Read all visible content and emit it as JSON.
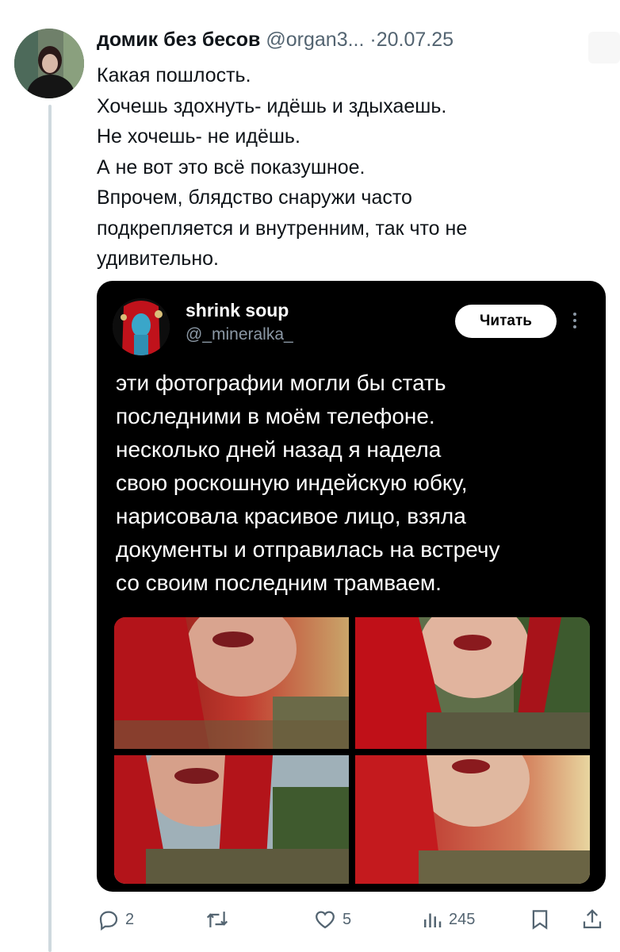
{
  "tweet": {
    "author_name": "домик без бесов",
    "author_handle": "@organ3...",
    "separator": "·",
    "date": "20.07.25",
    "lines": [
      "Какая пошлость.",
      "Хочешь здохнуть- идёшь и здыхаешь.",
      "Не хочешь- не идёшь.",
      "А не вот это всё показушное.",
      "Впрочем, блядство снаружи часто",
      "подкрепляется и внутренним, так что не",
      "удивительно."
    ]
  },
  "quoted": {
    "author_name": "shrink soup",
    "author_handle": "@_mineralka_",
    "read_button": "Читать",
    "lines": [
      "эти фотографии могли бы стать",
      "последними в моём телефоне.",
      "несколько дней назад я надела",
      "свою роскошную индейскую юбку,",
      "нарисовала красивое лицо, взяла",
      "документы и отправилась на встречу",
      "со своим последним трамваем."
    ],
    "photo_count": 4
  },
  "actions": {
    "replies": "2",
    "retweets": "",
    "likes": "5",
    "views": "245"
  },
  "colors": {
    "text": "#0f1419",
    "muted": "#536471",
    "quote_bg": "#000000",
    "thread_line": "#cfd9de"
  },
  "icons": [
    "reply-icon",
    "retweet-icon",
    "like-icon",
    "views-icon",
    "bookmark-icon",
    "share-icon",
    "kebab-icon"
  ]
}
